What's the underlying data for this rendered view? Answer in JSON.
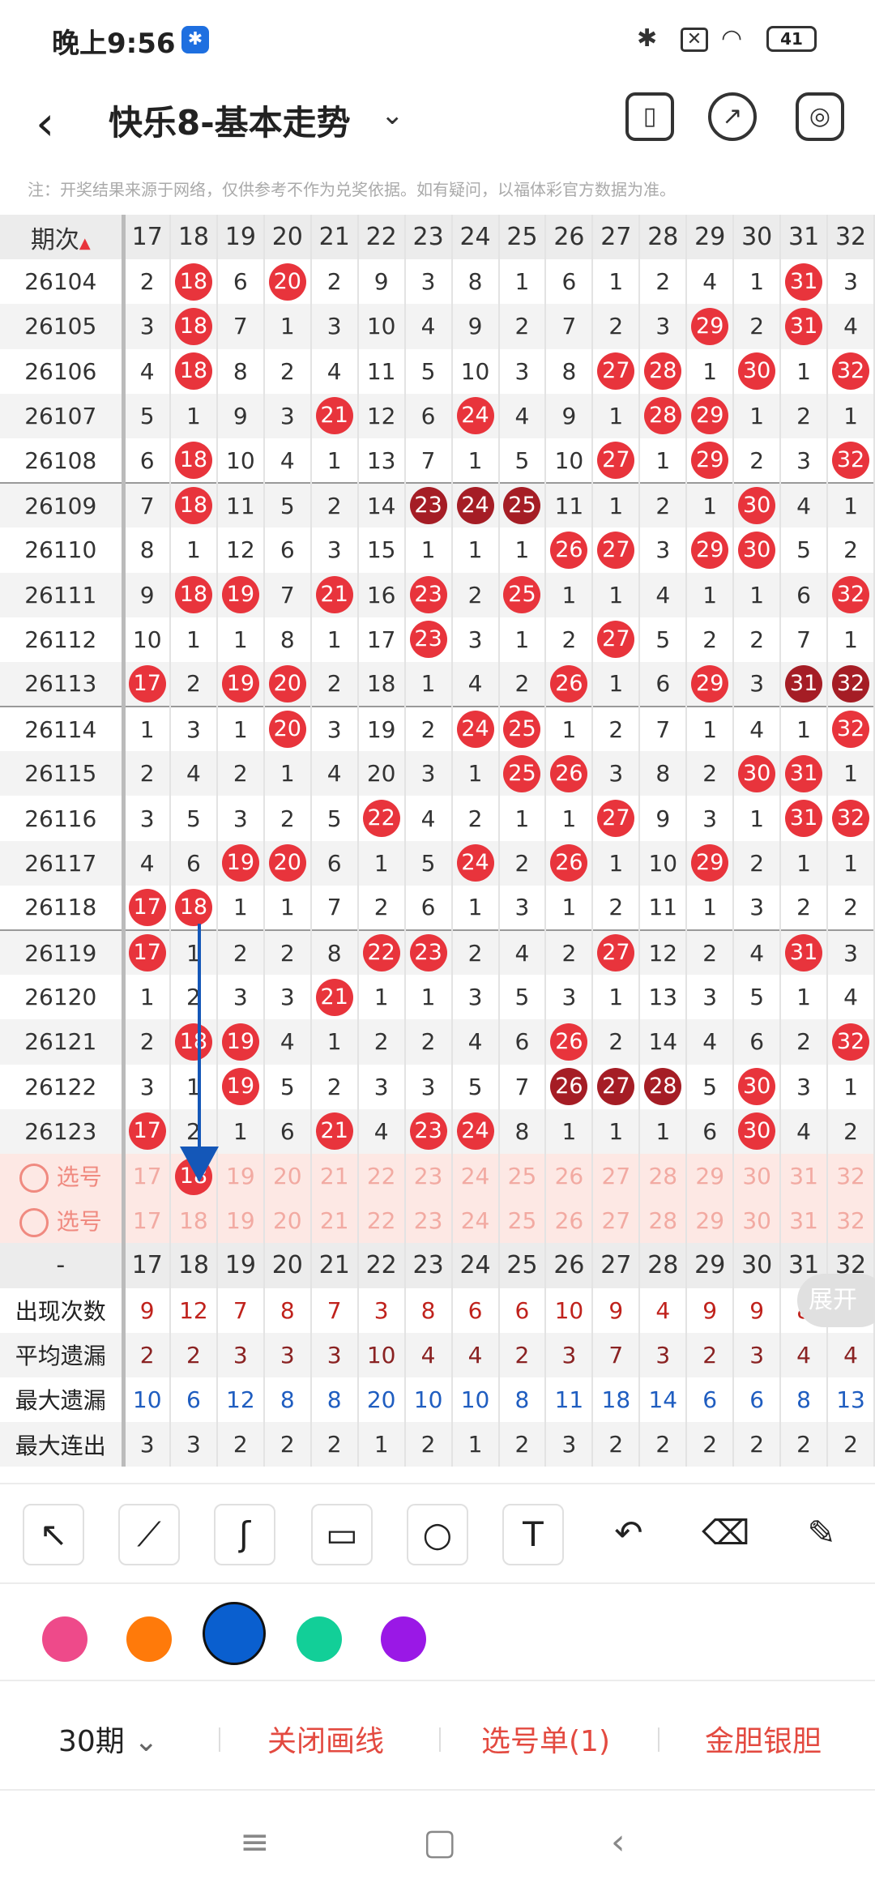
{
  "status": {
    "time": "晚上9:56",
    "battery": "41"
  },
  "app": {
    "title": "快乐8-基本走势"
  },
  "note": "注：开奖结果来源于网络，仅供参考不作为兑奖依据。如有疑问，以福体彩官方数据为准。",
  "table": {
    "issue_header": "期次",
    "columns": [
      "17",
      "18",
      "19",
      "20",
      "21",
      "22",
      "23",
      "24",
      "25",
      "26",
      "27",
      "28",
      "29",
      "30",
      "31",
      "32"
    ],
    "rows": [
      {
        "issue": "26104",
        "cells": [
          "2",
          "18",
          "6",
          "20",
          "2",
          "9",
          "3",
          "8",
          "1",
          "6",
          "1",
          "2",
          "4",
          "1",
          "31",
          "3"
        ]
      },
      {
        "issue": "26105",
        "cells": [
          "3",
          "18",
          "7",
          "1",
          "3",
          "10",
          "4",
          "9",
          "2",
          "7",
          "2",
          "3",
          "29",
          "2",
          "31",
          "4"
        ]
      },
      {
        "issue": "26106",
        "cells": [
          "4",
          "18",
          "8",
          "2",
          "4",
          "11",
          "5",
          "10",
          "3",
          "8",
          "27",
          "28",
          "1",
          "30",
          "1",
          "32"
        ]
      },
      {
        "issue": "26107",
        "cells": [
          "5",
          "1",
          "9",
          "3",
          "21",
          "12",
          "6",
          "24",
          "4",
          "9",
          "1",
          "28",
          "29",
          "1",
          "2",
          "1"
        ]
      },
      {
        "issue": "26108",
        "cells": [
          "6",
          "18",
          "10",
          "4",
          "1",
          "13",
          "7",
          "1",
          "5",
          "10",
          "27",
          "1",
          "29",
          "2",
          "3",
          "32"
        ]
      },
      {
        "issue": "26109",
        "cells": [
          "7",
          "18",
          "11",
          "5",
          "2",
          "14",
          "23",
          "24",
          "25",
          "11",
          "1",
          "2",
          "1",
          "30",
          "4",
          "1"
        ]
      },
      {
        "issue": "26110",
        "cells": [
          "8",
          "1",
          "12",
          "6",
          "3",
          "15",
          "1",
          "1",
          "1",
          "26",
          "27",
          "3",
          "29",
          "30",
          "5",
          "2"
        ]
      },
      {
        "issue": "26111",
        "cells": [
          "9",
          "18",
          "19",
          "7",
          "21",
          "16",
          "23",
          "2",
          "25",
          "1",
          "1",
          "4",
          "1",
          "1",
          "6",
          "32"
        ]
      },
      {
        "issue": "26112",
        "cells": [
          "10",
          "1",
          "1",
          "8",
          "1",
          "17",
          "23",
          "3",
          "1",
          "2",
          "27",
          "5",
          "2",
          "2",
          "7",
          "1"
        ]
      },
      {
        "issue": "26113",
        "cells": [
          "17",
          "2",
          "19",
          "20",
          "2",
          "18",
          "1",
          "4",
          "2",
          "26",
          "1",
          "6",
          "29",
          "3",
          "31",
          "32"
        ]
      },
      {
        "issue": "26114",
        "cells": [
          "1",
          "3",
          "1",
          "20",
          "3",
          "19",
          "2",
          "24",
          "25",
          "1",
          "2",
          "7",
          "1",
          "4",
          "1",
          "32"
        ]
      },
      {
        "issue": "26115",
        "cells": [
          "2",
          "4",
          "2",
          "1",
          "4",
          "20",
          "3",
          "1",
          "25",
          "26",
          "3",
          "8",
          "2",
          "30",
          "31",
          "1"
        ]
      },
      {
        "issue": "26116",
        "cells": [
          "3",
          "5",
          "3",
          "2",
          "5",
          "22",
          "4",
          "2",
          "1",
          "1",
          "27",
          "9",
          "3",
          "1",
          "31",
          "32"
        ]
      },
      {
        "issue": "26117",
        "cells": [
          "4",
          "6",
          "19",
          "20",
          "6",
          "1",
          "5",
          "24",
          "2",
          "26",
          "1",
          "10",
          "29",
          "2",
          "1",
          "1"
        ]
      },
      {
        "issue": "26118",
        "cells": [
          "17",
          "18",
          "1",
          "1",
          "7",
          "2",
          "6",
          "1",
          "3",
          "1",
          "2",
          "11",
          "1",
          "3",
          "2",
          "2"
        ]
      },
      {
        "issue": "26119",
        "cells": [
          "17",
          "1",
          "2",
          "2",
          "8",
          "22",
          "23",
          "2",
          "4",
          "2",
          "27",
          "12",
          "2",
          "4",
          "31",
          "3"
        ]
      },
      {
        "issue": "26120",
        "cells": [
          "1",
          "2",
          "3",
          "3",
          "21",
          "1",
          "1",
          "3",
          "5",
          "3",
          "1",
          "13",
          "3",
          "5",
          "1",
          "4"
        ]
      },
      {
        "issue": "26121",
        "cells": [
          "2",
          "18",
          "19",
          "4",
          "1",
          "2",
          "2",
          "4",
          "6",
          "26",
          "2",
          "14",
          "4",
          "6",
          "2",
          "32"
        ]
      },
      {
        "issue": "26122",
        "cells": [
          "3",
          "1",
          "19",
          "5",
          "2",
          "3",
          "3",
          "5",
          "7",
          "26",
          "27",
          "28",
          "5",
          "30",
          "3",
          "1"
        ]
      },
      {
        "issue": "26123",
        "cells": [
          "17",
          "2",
          "1",
          "6",
          "21",
          "4",
          "23",
          "24",
          "8",
          "1",
          "1",
          "1",
          "6",
          "30",
          "4",
          "2"
        ]
      }
    ],
    "dark_balls": [
      [
        "26109",
        "23"
      ],
      [
        "26109",
        "24"
      ],
      [
        "26109",
        "25"
      ],
      [
        "26113",
        "31"
      ],
      [
        "26113",
        "32"
      ],
      [
        "26122",
        "26"
      ],
      [
        "26122",
        "27"
      ],
      [
        "26122",
        "28"
      ]
    ],
    "pick_rows": [
      {
        "label": "选号",
        "selected": [
          "18"
        ]
      },
      {
        "label": "选号",
        "selected": []
      }
    ],
    "footer_header": "-",
    "stats": [
      {
        "label": "出现次数",
        "color": "red",
        "values": [
          "9",
          "12",
          "7",
          "8",
          "7",
          "3",
          "8",
          "6",
          "6",
          "10",
          "9",
          "4",
          "9",
          "9",
          "8",
          "4"
        ]
      },
      {
        "label": "平均遗漏",
        "color": "brown",
        "values": [
          "2",
          "2",
          "3",
          "3",
          "3",
          "10",
          "4",
          "4",
          "2",
          "3",
          "7",
          "3",
          "2",
          "3",
          "4",
          "4"
        ]
      },
      {
        "label": "最大遗漏",
        "color": "blue",
        "values": [
          "10",
          "6",
          "12",
          "8",
          "8",
          "20",
          "10",
          "10",
          "8",
          "11",
          "18",
          "14",
          "6",
          "6",
          "8",
          "13"
        ]
      },
      {
        "label": "最大连出",
        "color": "dark",
        "values": [
          "3",
          "3",
          "2",
          "2",
          "2",
          "1",
          "2",
          "1",
          "2",
          "3",
          "2",
          "2",
          "2",
          "2",
          "2",
          "2"
        ]
      }
    ]
  },
  "expand_label": "展开",
  "tools": [
    "arrow-tool",
    "line-tool",
    "curve-tool",
    "rect-tool",
    "circle-tool",
    "text-tool",
    "undo-tool",
    "eraser-tool",
    "clear-tool"
  ],
  "palette": [
    "#ee4a8a",
    "#ff7a0a",
    "#0a5fcf",
    "#12cf98",
    "#9a18e6"
  ],
  "bottom": {
    "period": "30期",
    "close_draw": "关闭画线",
    "pick_list": "选号单(1)",
    "gold": "金胆银胆"
  }
}
